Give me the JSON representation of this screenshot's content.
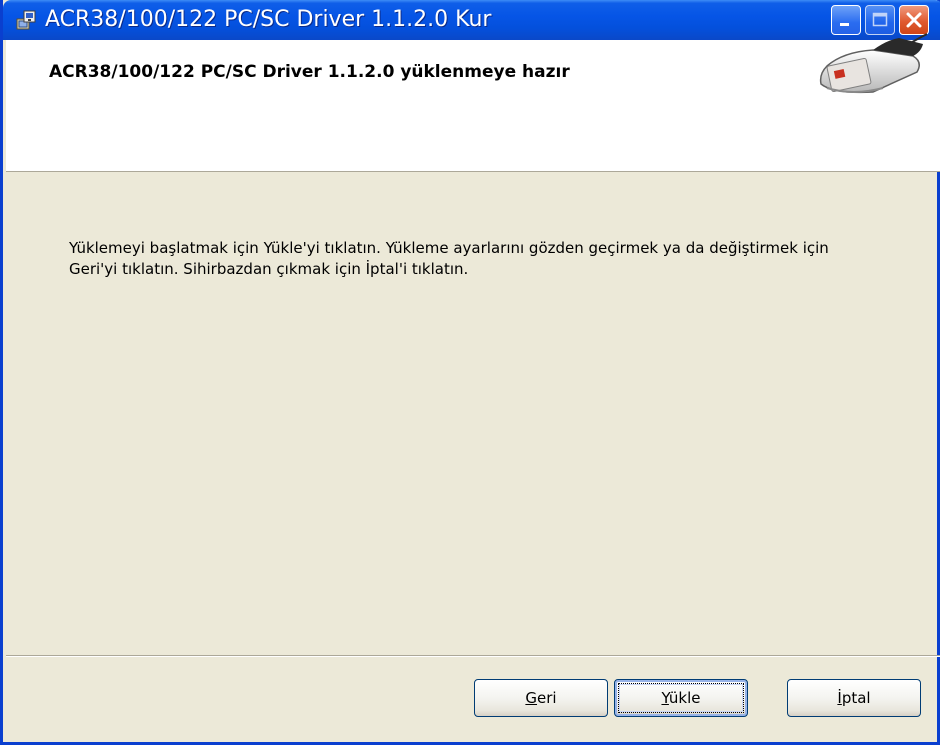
{
  "window": {
    "title": "ACR38/100/122 PC/SC Driver 1.1.2.0 Kur",
    "icon": "installer-icon",
    "controls": {
      "minimize": "minimize-icon",
      "maximize": "maximize-icon",
      "close": "close-icon"
    }
  },
  "banner": {
    "title": "ACR38/100/122 PC/SC Driver 1.1.2.0 yüklenmeye hazır",
    "image": "card-reader-image"
  },
  "body": {
    "message": "Yüklemeyi başlatmak için Yükle'yi tıklatın. Yükleme ayarlarını gözden geçirmek ya da değiştirmek için Geri'yi tıklatın. Sihirbazdan çıkmak için İptal'i tıklatın."
  },
  "buttons": {
    "back": {
      "mnemonic": "G",
      "rest": "eri"
    },
    "install": {
      "mnemonic": "Y",
      "rest": "ükle"
    },
    "cancel": {
      "mnemonic": "İ",
      "rest": "ptal"
    }
  },
  "colors": {
    "titlebar": "#0655e6",
    "dialog_bg": "#ece9d8",
    "banner_bg": "#ffffff",
    "close_button": "#e05a30"
  }
}
